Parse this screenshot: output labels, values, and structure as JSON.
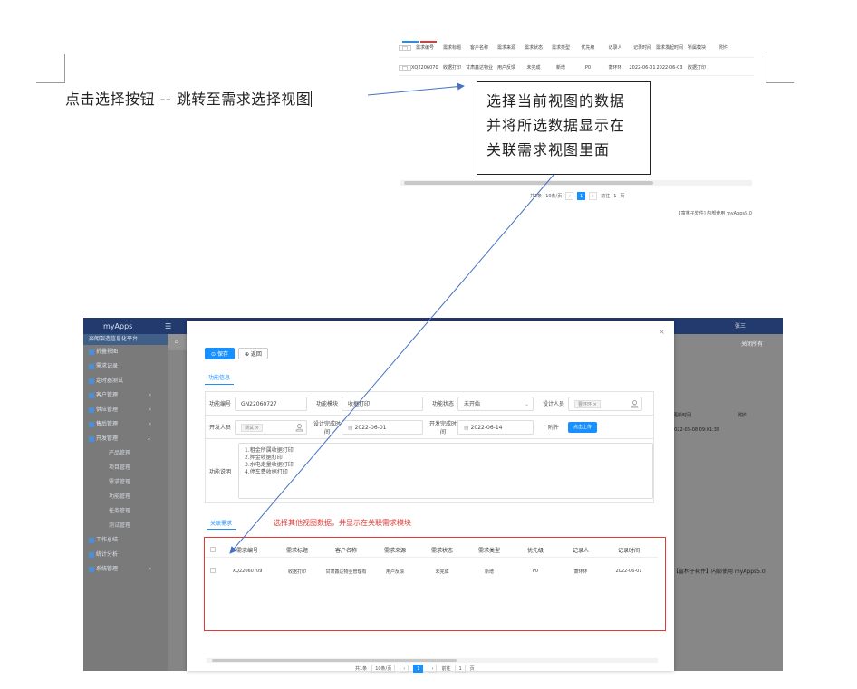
{
  "colors": {
    "accent": "#1890ff",
    "annotation_red": "#e53935",
    "arrow_blue": "#4472c4",
    "app_topbar": "#233a6f"
  },
  "doc": {
    "main_text": "点击选择按钮  --  跳转至需求选择视图",
    "callout": [
      "选择当前视图的数据",
      "并将所选数据显示在",
      "关联需求视图里面"
    ]
  },
  "top_shot": {
    "headers": [
      "需求编号",
      "需求标题",
      "客户名称",
      "需求来源",
      "需求状态",
      "需求类型",
      "优先级",
      "记录人",
      "记录时间",
      "需求发起时间",
      "所属模块",
      "附件"
    ],
    "row": [
      "XQ22060709",
      "收据打印",
      "甘肃鑫达物业管理有限",
      "用户反馈",
      "未完成",
      "新增",
      "P0",
      "萧环环",
      "2022-06-01",
      "2022-06-03",
      "收据打印",
      ""
    ],
    "pager": {
      "total": "共1条",
      "per_page": "10条/页",
      "page": "1",
      "goto_label": "前往",
      "goto_value": "1",
      "goto_unit": "页"
    },
    "footer": "[富林子软件] 内部使用 myApps5.0"
  },
  "app": {
    "logo": "myApps",
    "system_name": "奔朗製造信息化平台",
    "tab_close_all": "关闭所有",
    "user": "张三",
    "sidebar": [
      {
        "label": "折叠视图",
        "sub": false
      },
      {
        "label": "需求记录",
        "sub": false
      },
      {
        "label": "定时器测试",
        "sub": false
      },
      {
        "label": "客户管理",
        "sub": false,
        "arrow": "‹"
      },
      {
        "label": "供应管理",
        "sub": false,
        "arrow": "‹"
      },
      {
        "label": "售后管理",
        "sub": false,
        "arrow": "‹"
      },
      {
        "label": "开发管理",
        "sub": false,
        "arrow": "⌄"
      },
      {
        "label": "产品管理",
        "sub": true
      },
      {
        "label": "项目管理",
        "sub": true
      },
      {
        "label": "需求管理",
        "sub": true
      },
      {
        "label": "功能管理",
        "sub": true
      },
      {
        "label": "任务管理",
        "sub": true
      },
      {
        "label": "测试管理",
        "sub": true
      },
      {
        "label": "工作总结",
        "sub": false
      },
      {
        "label": "统计分析",
        "sub": false
      },
      {
        "label": "系统管理",
        "sub": false,
        "arrow": "‹"
      }
    ],
    "right_bg": {
      "col1": "更新时间",
      "col2": "附件",
      "value": "2022-06-08 09:01:38",
      "footer": "【富林子软件】内部使用 myApps5.0"
    }
  },
  "modal": {
    "save_label": "保存",
    "back_label": "返回",
    "section_tab": "功能信息",
    "form": {
      "code_label": "功能编号",
      "code_value": "GN22060727",
      "module_label": "功能模块",
      "module_value": "收据打印",
      "status_label": "功能状态",
      "status_value": "未开始",
      "designer_label": "设计人员",
      "designer_value": "曹环环",
      "dev_label": "开发人员",
      "dev_value": "测试",
      "design_done_label": "设计完成时间",
      "design_done_value": "2022-06-01",
      "dev_done_label": "开发完成时间",
      "dev_done_value": "2022-06-14",
      "attach_label": "附件",
      "upload_label": "点击上传",
      "desc_label": "功能说明",
      "desc_lines": [
        "1.租金所属收据打印",
        "2.押金收据打印",
        "3.水电走量收据打印",
        "4.停车费收据打印"
      ]
    },
    "rel_tab": "关联需求",
    "annotation": "选择其他视图数据，并显示在关联需求模块",
    "rel_headers": [
      "需求编号",
      "需求标题",
      "客户名称",
      "需求来源",
      "需求状态",
      "需求类型",
      "优先级",
      "记录人",
      "记录时间"
    ],
    "rel_row": [
      "XQ22060709",
      "收据打印",
      "甘肃鑫达物业管理有",
      "用户反馈",
      "未完成",
      "新增",
      "P0",
      "萧环环",
      "2022-06-01"
    ],
    "pager": {
      "total": "共1条",
      "per_page": "10条/页",
      "page": "1",
      "goto_label": "前往",
      "goto_value": "1",
      "goto_unit": "页"
    }
  }
}
